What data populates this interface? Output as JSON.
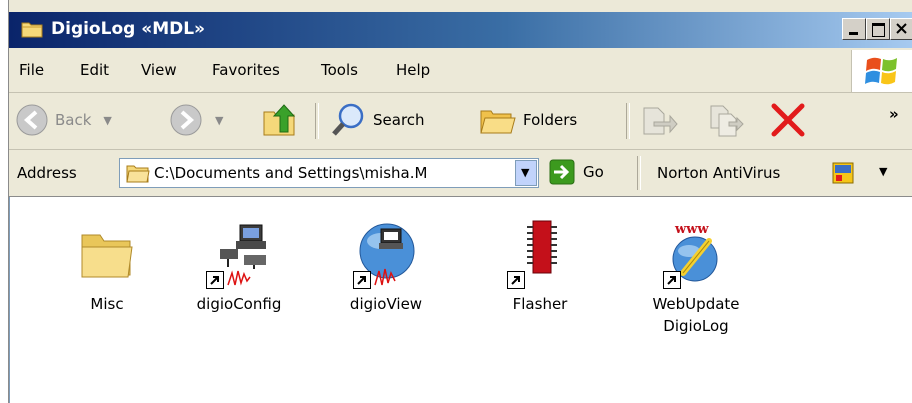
{
  "window": {
    "title": "DigioLog «MDL»"
  },
  "menubar": {
    "items": [
      "File",
      "Edit",
      "View",
      "Favorites",
      "Tools",
      "Help"
    ]
  },
  "toolbar": {
    "back_label": "Back",
    "search_label": "Search",
    "folders_label": "Folders",
    "more": "»"
  },
  "address": {
    "label": "Address",
    "value": "C:\\Documents and Settings\\misha.M",
    "go_label": "Go",
    "norton_label": "Norton AntiVirus"
  },
  "files": [
    {
      "name": "Misc",
      "icon": "folder-icon"
    },
    {
      "name": "digioConfig",
      "icon": "network-computer-icon"
    },
    {
      "name": "digioView",
      "icon": "globe-computer-icon"
    },
    {
      "name": "Flasher",
      "icon": "chip-icon"
    },
    {
      "name": "WebUpdate DigioLog",
      "icon": "www-globe-icon"
    }
  ],
  "colors": {
    "title_start": "#0a246a",
    "title_end": "#a6caf0",
    "chrome": "#ece9d8",
    "close_red": "#e21b1b",
    "go_green": "#3c9a1e"
  }
}
